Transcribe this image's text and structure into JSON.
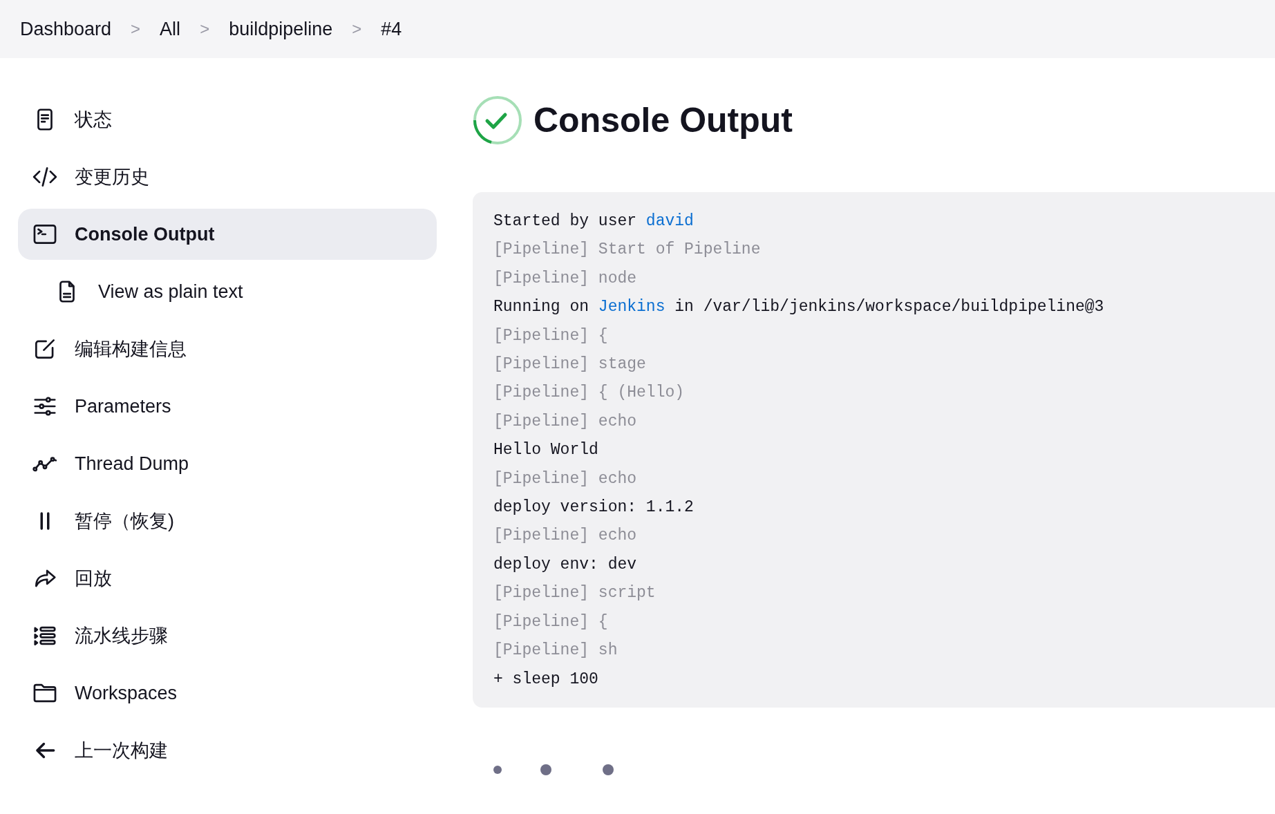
{
  "breadcrumb": [
    {
      "label": "Dashboard"
    },
    {
      "label": "All"
    },
    {
      "label": "buildpipeline"
    },
    {
      "label": "#4"
    }
  ],
  "breadcrumb_separator": ">",
  "sidebar": {
    "items": [
      {
        "label": "状态",
        "selected": false
      },
      {
        "label": "变更历史",
        "selected": false
      },
      {
        "label": "Console Output",
        "selected": true,
        "children": [
          {
            "label": "View as plain text",
            "selected": false
          }
        ]
      },
      {
        "label": "编辑构建信息",
        "selected": false
      },
      {
        "label": "Parameters",
        "selected": false
      },
      {
        "label": "Thread Dump",
        "selected": false
      },
      {
        "label": "暂停（恢复)",
        "selected": false
      },
      {
        "label": "回放",
        "selected": false
      },
      {
        "label": "流水线步骤",
        "selected": false
      },
      {
        "label": "Workspaces",
        "selected": false
      },
      {
        "label": "上一次构建",
        "selected": false
      }
    ]
  },
  "page": {
    "title": "Console Output"
  },
  "console": {
    "lines": [
      {
        "kind": "output",
        "segments": [
          {
            "text": "Started by user "
          },
          {
            "text": "david",
            "kind": "link"
          }
        ]
      },
      {
        "kind": "pipeline",
        "segments": [
          {
            "text": "[Pipeline] Start of Pipeline"
          }
        ]
      },
      {
        "kind": "pipeline",
        "segments": [
          {
            "text": "[Pipeline] node"
          }
        ]
      },
      {
        "kind": "output",
        "segments": [
          {
            "text": "Running on "
          },
          {
            "text": "Jenkins",
            "kind": "link"
          },
          {
            "text": " in /var/lib/jenkins/workspace/buildpipeline@3"
          }
        ]
      },
      {
        "kind": "pipeline",
        "segments": [
          {
            "text": "[Pipeline] {"
          }
        ]
      },
      {
        "kind": "pipeline",
        "segments": [
          {
            "text": "[Pipeline] stage"
          }
        ]
      },
      {
        "kind": "pipeline",
        "segments": [
          {
            "text": "[Pipeline] { (Hello)"
          }
        ]
      },
      {
        "kind": "pipeline",
        "segments": [
          {
            "text": "[Pipeline] echo"
          }
        ]
      },
      {
        "kind": "output",
        "segments": [
          {
            "text": "Hello World"
          }
        ]
      },
      {
        "kind": "pipeline",
        "segments": [
          {
            "text": "[Pipeline] echo"
          }
        ]
      },
      {
        "kind": "output",
        "segments": [
          {
            "text": "deploy version: 1.1.2"
          }
        ]
      },
      {
        "kind": "pipeline",
        "segments": [
          {
            "text": "[Pipeline] echo"
          }
        ]
      },
      {
        "kind": "output",
        "segments": [
          {
            "text": "deploy env: dev"
          }
        ]
      },
      {
        "kind": "pipeline",
        "segments": [
          {
            "text": "[Pipeline] script"
          }
        ]
      },
      {
        "kind": "pipeline",
        "segments": [
          {
            "text": "[Pipeline] {"
          }
        ]
      },
      {
        "kind": "pipeline",
        "segments": [
          {
            "text": "[Pipeline] sh"
          }
        ]
      },
      {
        "kind": "output",
        "segments": [
          {
            "text": "+ sleep 100"
          }
        ]
      }
    ]
  }
}
